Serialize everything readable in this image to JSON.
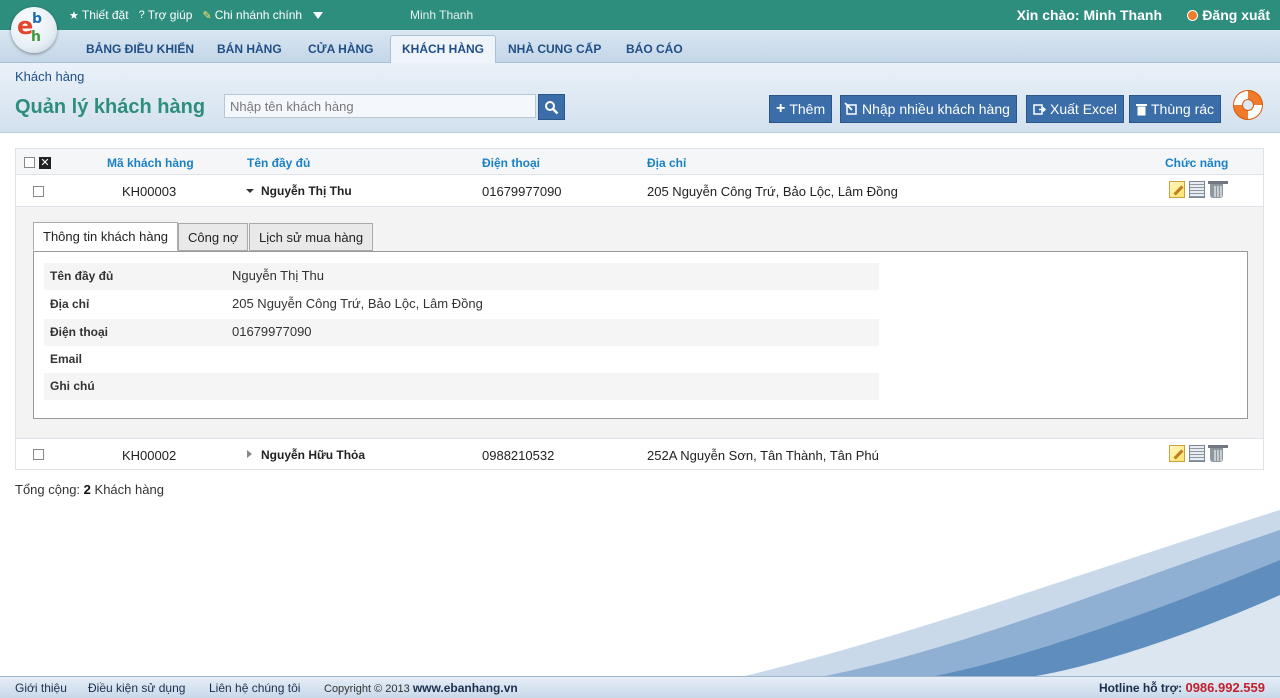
{
  "topbar": {
    "links": [
      {
        "icon": "star-icon",
        "label": "Thiết đặt"
      },
      {
        "icon": "question-icon",
        "label": "Trợ giúp"
      },
      {
        "icon": "branch-icon",
        "label": "Chi nhánh chính"
      }
    ],
    "branch_user": "Minh Thanh",
    "greeting": "Xin chào: Minh Thanh",
    "logout_label": "Đăng xuất"
  },
  "nav": {
    "items": [
      "BẢNG ĐIỀU KHIỂN",
      "BÁN HÀNG",
      "CỬA HÀNG",
      "KHÁCH HÀNG",
      "NHÀ CUNG CẤP",
      "BÁO CÁO"
    ],
    "active": "KHÁCH HÀNG"
  },
  "header": {
    "breadcrumb": "Khách hàng",
    "title": "Quản lý khách hàng",
    "search_placeholder": "Nhập tên khách hàng",
    "search_value": "",
    "buttons": {
      "add": "Thêm",
      "import": "Nhập nhiều khách hàng",
      "export": "Xuất Excel",
      "trash": "Thùng rác"
    }
  },
  "table": {
    "columns": {
      "code": "Mã khách hàng",
      "name": "Tên đầy đủ",
      "phone": "Điện thoại",
      "address": "Địa chỉ",
      "actions": "Chức năng"
    },
    "rows": [
      {
        "code": "KH00003",
        "name": "Nguyễn Thị Thu",
        "phone": "01679977090",
        "address": "205 Nguyễn Công Trứ, Bảo Lộc, Lâm Đồng",
        "expanded": true
      },
      {
        "code": "KH00002",
        "name": "Nguyễn Hữu Thỏa",
        "phone": "0988210532",
        "address": "252A Nguyễn Sơn, Tân Thành, Tân Phú",
        "expanded": false
      }
    ],
    "detail": {
      "tabs": [
        "Thông tin khách hàng",
        "Công nợ",
        "Lịch sử mua hàng"
      ],
      "active_tab": "Thông tin khách hàng",
      "fields": [
        {
          "label": "Tên đầy đủ",
          "value": "Nguyễn Thị Thu"
        },
        {
          "label": "Địa chỉ",
          "value": "205 Nguyễn Công Trứ, Bảo Lộc, Lâm Đồng"
        },
        {
          "label": "Điện thoại",
          "value": "01679977090"
        },
        {
          "label": "Email",
          "value": ""
        },
        {
          "label": "Ghi chú",
          "value": ""
        }
      ]
    },
    "total_label": "Tổng cộng:",
    "total_count": "2",
    "total_unit": "Khách hàng"
  },
  "footer": {
    "links": [
      "Giới thiệu",
      "Điều kiện sử dụng",
      "Liên hệ chúng tôi"
    ],
    "copyright_prefix": "Copyright © 2013",
    "site": "www.ebanhang.vn",
    "hotline_label": "Hotline hỗ trợ:",
    "hotline_number": "0986.992.559"
  },
  "colors": {
    "topbar": "#2e8e7e",
    "button": "#3b6ea8",
    "column_header": "#1a82c4",
    "hotline": "#c0212c"
  }
}
